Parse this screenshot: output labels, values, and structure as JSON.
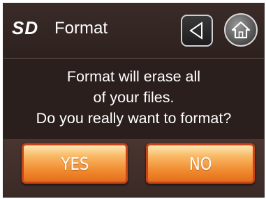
{
  "header": {
    "sd_label": "SD",
    "title": "Format",
    "back_icon": "back-triangle-icon",
    "home_icon": "home-icon"
  },
  "dialog": {
    "message_lines": [
      "Format will erase all",
      "of your files.",
      "Do you really want to format?"
    ],
    "yes_label": "YES",
    "no_label": "NO"
  },
  "colors": {
    "background": "#2a1f1d",
    "button_orange": "#f08a2e",
    "button_border": "#c8451a",
    "text": "#ffffff"
  }
}
